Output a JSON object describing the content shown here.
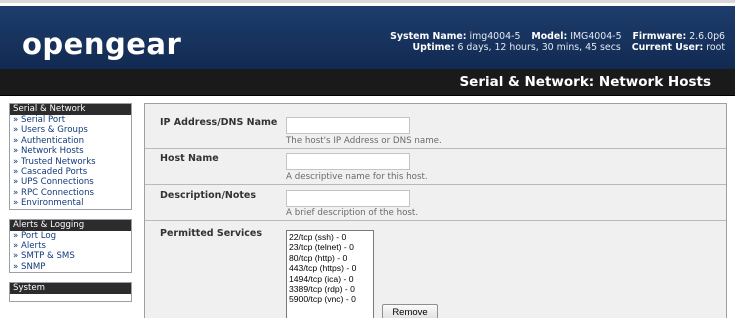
{
  "header": {
    "logo": "opengear",
    "system_name_label": "System Name:",
    "system_name": "img4004-5",
    "model_label": "Model:",
    "model": "IMG4004-5",
    "firmware_label": "Firmware:",
    "firmware": "2.6.0p6",
    "uptime_label": "Uptime:",
    "uptime": "6 days, 12 hours, 30 mins, 45 secs",
    "current_user_label": "Current User:",
    "current_user": "root",
    "bar_color": "#1b3a68"
  },
  "page_title": "Serial & Network: Network Hosts",
  "sidebar": {
    "groups": [
      {
        "title": "Serial & Network",
        "items": [
          "Serial Port",
          "Users & Groups",
          "Authentication",
          "Network Hosts",
          "Trusted Networks",
          "Cascaded Ports",
          "UPS Connections",
          "RPC Connections",
          "Environmental"
        ]
      },
      {
        "title": "Alerts & Logging",
        "items": [
          "Port Log",
          "Alerts",
          "SMTP & SMS",
          "SNMP"
        ]
      },
      {
        "title": "System",
        "items": []
      }
    ]
  },
  "form": {
    "ip": {
      "label": "IP Address/DNS Name",
      "value": "",
      "hint": "The host's IP Address or DNS name."
    },
    "hostname": {
      "label": "Host Name",
      "value": "",
      "hint": "A descriptive name for this host."
    },
    "description": {
      "label": "Description/Notes",
      "value": "",
      "hint": "A brief description of the host."
    },
    "services": {
      "label": "Permitted Services",
      "options": [
        "22/tcp (ssh) - 0",
        "23/tcp (telnet) - 0",
        "80/tcp (http) - 0",
        "443/tcp (https) - 0",
        "1494/tcp (ica) - 0",
        "3389/tcp (rdp) - 0",
        "5900/tcp (vnc) - 0"
      ],
      "remove_label": "Remove"
    }
  }
}
